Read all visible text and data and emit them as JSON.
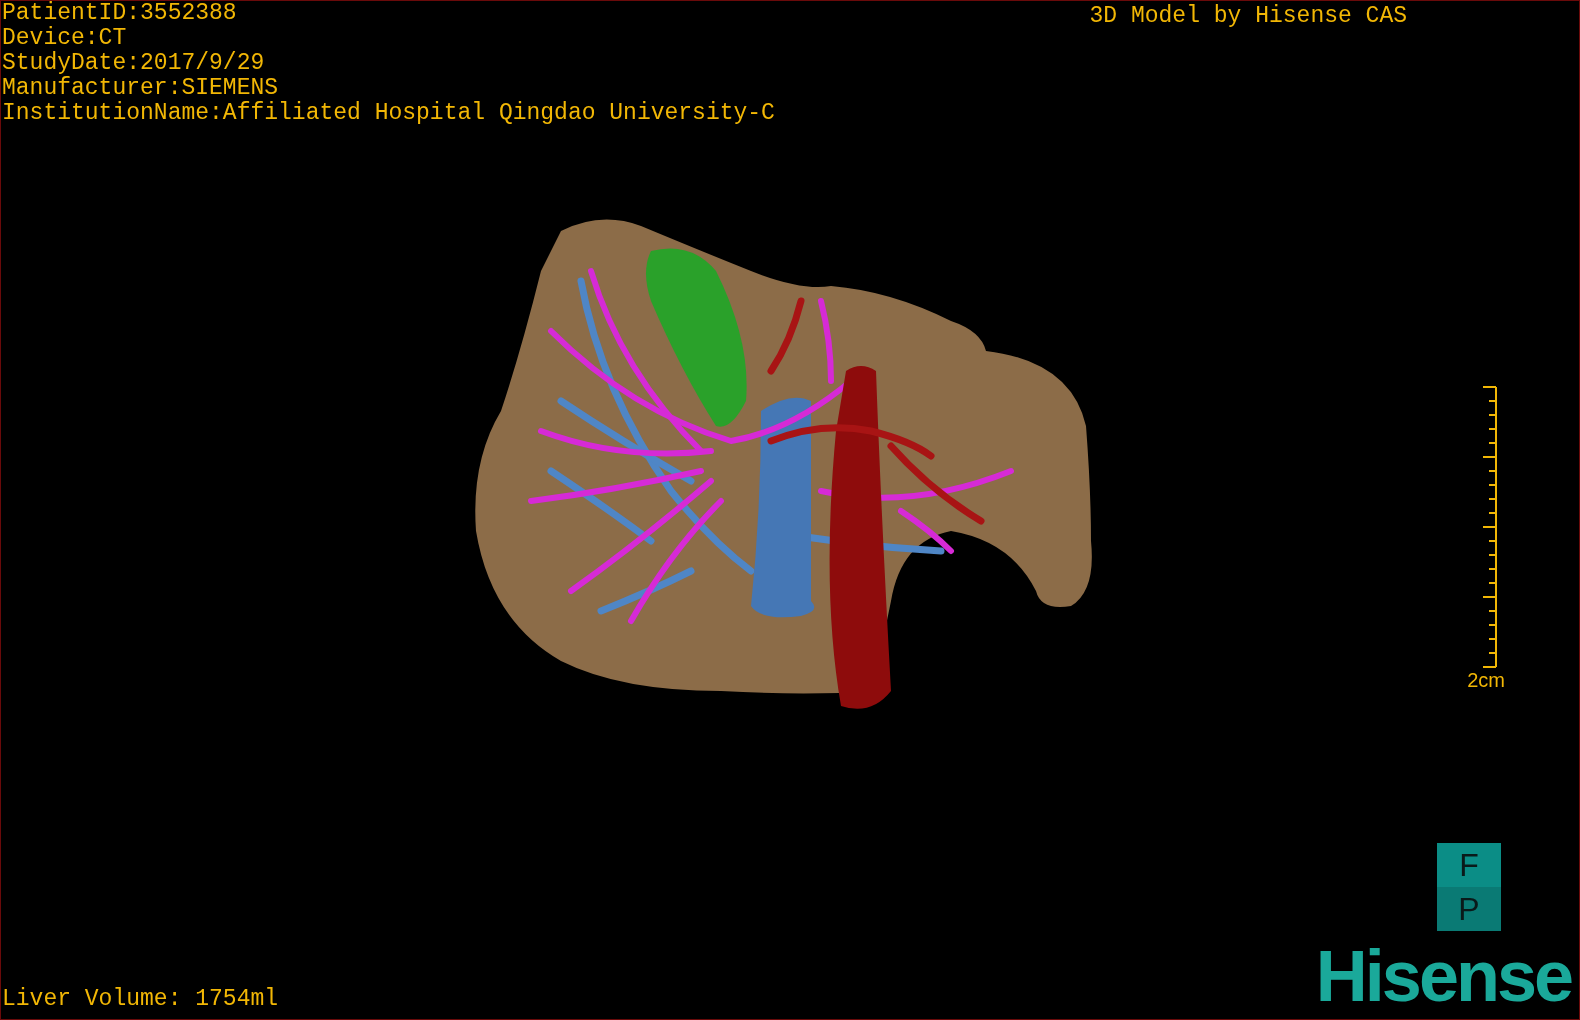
{
  "study_info": [
    "PatientID:3552388",
    "Device:CT",
    "StudyDate:2017/9/29",
    "Manufacturer:SIEMENS",
    "InstitutionName:Affiliated Hospital Qingdao University-C"
  ],
  "model_title": "3D Model by Hisense CAS",
  "scale_bar": {
    "label": "2cm"
  },
  "orientation_cube": {
    "top_face": "F",
    "bottom_face": "P"
  },
  "liver_volume": "Liver Volume: 1754ml",
  "logo": "Hisense"
}
